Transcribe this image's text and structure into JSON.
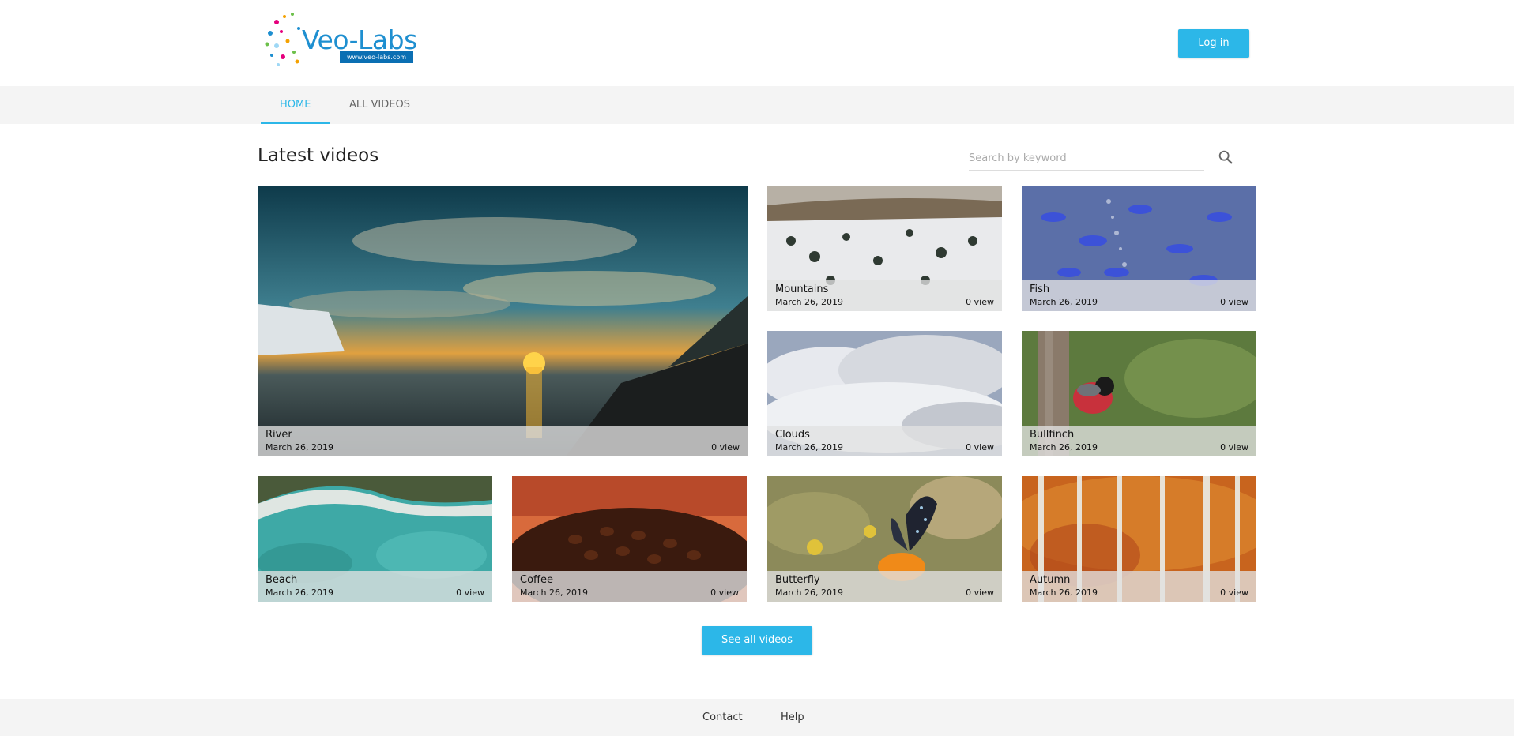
{
  "header": {
    "logo_text": "Veo-Labs",
    "logo_tagline": "www.veo-labs.com",
    "login_label": "Log in",
    "accent_color": "#2cb7e8"
  },
  "nav": {
    "tabs": [
      {
        "label": "HOME",
        "active": true
      },
      {
        "label": "ALL VIDEOS",
        "active": false
      }
    ]
  },
  "main": {
    "section_title": "Latest videos",
    "search_placeholder": "Search by keyword",
    "videos": [
      {
        "title": "River",
        "date": "March 26, 2019",
        "views": "0 view"
      },
      {
        "title": "Mountains",
        "date": "March 26, 2019",
        "views": "0 view"
      },
      {
        "title": "Fish",
        "date": "March 26, 2019",
        "views": "0 view"
      },
      {
        "title": "Clouds",
        "date": "March 26, 2019",
        "views": "0 view"
      },
      {
        "title": "Bullfinch",
        "date": "March 26, 2019",
        "views": "0 view"
      },
      {
        "title": "Beach",
        "date": "March 26, 2019",
        "views": "0 view"
      },
      {
        "title": "Coffee",
        "date": "March 26, 2019",
        "views": "0 view"
      },
      {
        "title": "Butterfly",
        "date": "March 26, 2019",
        "views": "0 view"
      },
      {
        "title": "Autumn",
        "date": "March 26, 2019",
        "views": "0 view"
      }
    ],
    "see_all_label": "See all videos"
  },
  "footer": {
    "links": [
      "Contact",
      "Help"
    ]
  }
}
